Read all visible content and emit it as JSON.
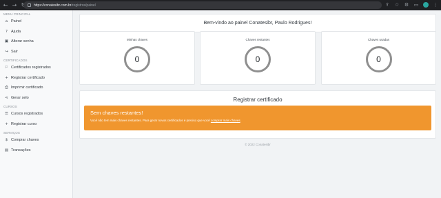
{
  "browser": {
    "url_host": "https://conatesibr.com.br",
    "url_path": "/registros/painel"
  },
  "sidebar": {
    "sections": [
      {
        "header": "Menu principal",
        "items": [
          {
            "label": "Painel",
            "icon": "home-icon"
          },
          {
            "label": "Ajuda",
            "icon": "help-icon"
          },
          {
            "label": "Alterar senha",
            "icon": "lock-icon"
          },
          {
            "label": "Sair",
            "icon": "logout-icon"
          }
        ]
      },
      {
        "header": "Certificados",
        "items": [
          {
            "label": "Certificados registrados",
            "icon": "certificate-icon"
          },
          {
            "label": "Registrar certificado",
            "icon": "plus-icon"
          },
          {
            "label": "Imprimir certificado",
            "icon": "print-icon"
          },
          {
            "label": "Gerar selo",
            "icon": "share-icon"
          }
        ]
      },
      {
        "header": "Cursos",
        "items": [
          {
            "label": "Cursos registrados",
            "icon": "list-icon"
          },
          {
            "label": "Registrar curso",
            "icon": "plus-icon"
          }
        ]
      },
      {
        "header": "Serviços",
        "items": [
          {
            "label": "Comprar chaves",
            "icon": "dollar-icon"
          },
          {
            "label": "Transações",
            "icon": "receipt-icon"
          }
        ]
      }
    ]
  },
  "welcome": "Bem-vindo ao painel Conatesibr, Paulo Rodrigues!",
  "stats": [
    {
      "title": "Minhas chaves",
      "value": "0"
    },
    {
      "title": "Chaves restantes",
      "value": "0"
    },
    {
      "title": "Chaves usadas",
      "value": "0"
    }
  ],
  "register": {
    "title": "Registrar certificado",
    "alert_title": "Sem chaves restantes!",
    "alert_text": "Você não tem mais chaves restantes. Para gerar novos certificados é preciso que você ",
    "alert_link": "comprar mais chaves",
    "alert_end": "."
  },
  "footer": "© 2022 Conatesibr",
  "colors": {
    "accent": "#f0962e",
    "ring": "#8f8f8f"
  }
}
